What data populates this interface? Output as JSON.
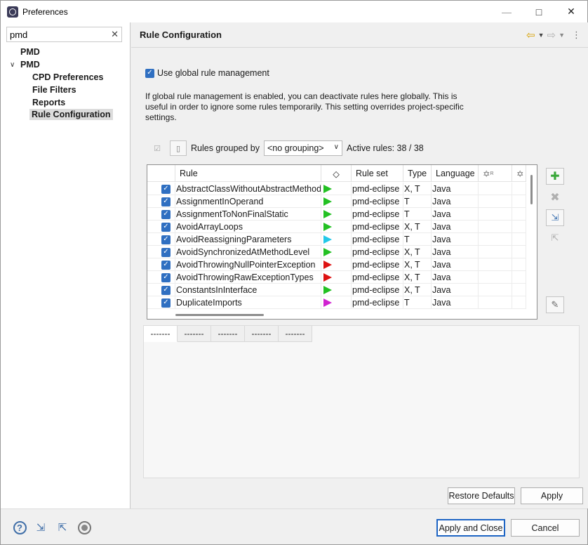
{
  "window": {
    "title": "Preferences"
  },
  "sidebar": {
    "search_value": "pmd",
    "tree": [
      {
        "label": "PMD",
        "level": 0,
        "expandable": false
      },
      {
        "label": "PMD",
        "level": 0,
        "expandable": true
      },
      {
        "label": "CPD Preferences",
        "level": 1
      },
      {
        "label": "File Filters",
        "level": 1
      },
      {
        "label": "Reports",
        "level": 1
      },
      {
        "label": "Rule Configuration",
        "level": 1,
        "selected": true
      }
    ]
  },
  "page": {
    "title": "Rule Configuration",
    "global_checkbox_label": "Use global rule management",
    "global_checked": true,
    "description": "If global rule management is enabled, you can deactivate rules here globally. This is useful in order to ignore some rules temporarily. This setting overrides project-specific settings.",
    "grouped_by_label": "Rules grouped by",
    "grouping_value": "<no grouping>",
    "active_rules": "Active rules: 38 / 38"
  },
  "table": {
    "columns": [
      "Rule",
      "◇",
      "Rule set",
      "Type",
      "Language"
    ],
    "rows": [
      {
        "checked": true,
        "rule": "AbstractClassWithoutAbstractMethod",
        "priority_color": "#22c022",
        "ruleset": "pmd-eclipse",
        "type": "X, T",
        "language": "Java"
      },
      {
        "checked": true,
        "rule": "AssignmentInOperand",
        "priority_color": "#22c022",
        "ruleset": "pmd-eclipse",
        "type": "T",
        "language": "Java"
      },
      {
        "checked": true,
        "rule": "AssignmentToNonFinalStatic",
        "priority_color": "#22c022",
        "ruleset": "pmd-eclipse",
        "type": "T",
        "language": "Java"
      },
      {
        "checked": true,
        "rule": "AvoidArrayLoops",
        "priority_color": "#22c022",
        "ruleset": "pmd-eclipse",
        "type": "X, T",
        "language": "Java"
      },
      {
        "checked": true,
        "rule": "AvoidReassigningParameters",
        "priority_color": "#22c8e8",
        "ruleset": "pmd-eclipse",
        "type": "T",
        "language": "Java"
      },
      {
        "checked": true,
        "rule": "AvoidSynchronizedAtMethodLevel",
        "priority_color": "#22c022",
        "ruleset": "pmd-eclipse",
        "type": "X, T",
        "language": "Java"
      },
      {
        "checked": true,
        "rule": "AvoidThrowingNullPointerException",
        "priority_color": "#dd1111",
        "ruleset": "pmd-eclipse",
        "type": "X, T",
        "language": "Java"
      },
      {
        "checked": true,
        "rule": "AvoidThrowingRawExceptionTypes",
        "priority_color": "#dd1111",
        "ruleset": "pmd-eclipse",
        "type": "X, T",
        "language": "Java"
      },
      {
        "checked": true,
        "rule": "ConstantsInInterface",
        "priority_color": "#22c022",
        "ruleset": "pmd-eclipse",
        "type": "X, T",
        "language": "Java"
      },
      {
        "checked": true,
        "rule": "DuplicateImports",
        "priority_color": "#d022d0",
        "ruleset": "pmd-eclipse",
        "type": "T",
        "language": "Java"
      }
    ]
  },
  "tabs": [
    "-------",
    "-------",
    "-------",
    "-------",
    "-------"
  ],
  "buttons": {
    "restore_defaults": "Restore Defaults",
    "apply": "Apply",
    "apply_and_close": "Apply and Close",
    "cancel": "Cancel"
  },
  "icons": {
    "add": "add-icon",
    "remove": "remove-icon",
    "import": "import-icon",
    "export": "export-icon",
    "edit": "edit-rule-icon"
  }
}
